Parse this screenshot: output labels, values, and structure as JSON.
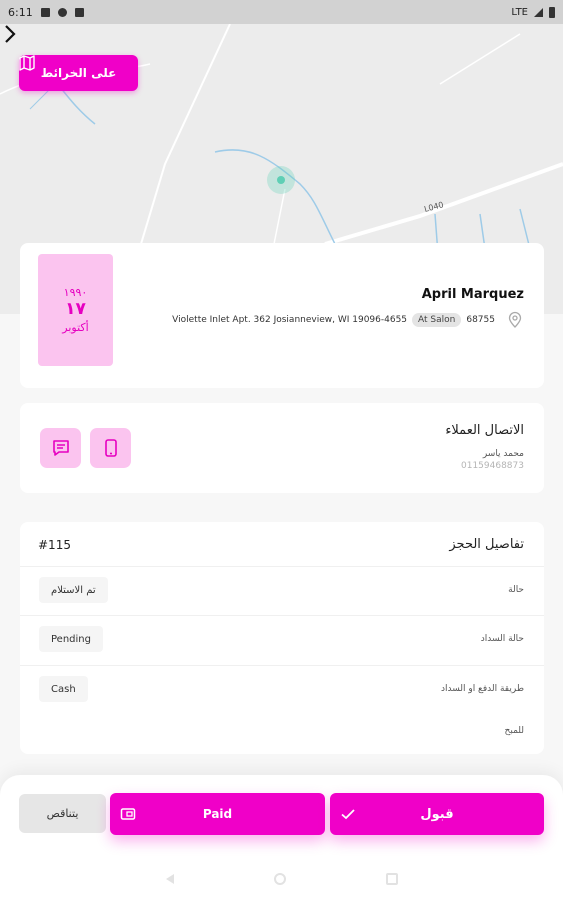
{
  "status_bar": {
    "time": "6:11",
    "network": "LTE"
  },
  "map": {
    "map_button_label": "على الخرائط"
  },
  "customer": {
    "name": "April Marquez",
    "address": "Violette Inlet Apt. 362 Josianneview, WI 19096-4655",
    "location_badge": "At Salon",
    "address_suffix": "68755",
    "date": {
      "year": "١٩٩٠",
      "day": "١٧",
      "month": "أكتوبر"
    }
  },
  "contact": {
    "title": "الاتصال العملاء",
    "person_name": "محمد ياسر",
    "phone": "01159468873"
  },
  "booking": {
    "title": "تفاصيل الحجز",
    "id": "#115",
    "rows": [
      {
        "label": "حالة",
        "value": "تم الاستلام"
      },
      {
        "label": "حالة السداد",
        "value": "Pending"
      },
      {
        "label": "طريقة الدفع او السداد",
        "value": "Cash"
      },
      {
        "label": "للمبح",
        "value": ""
      }
    ]
  },
  "actions": {
    "decline_label": "يتناقص",
    "paid_label": "Paid",
    "accept_label": "قبول"
  },
  "colors": {
    "accent": "#f000c8",
    "accent_light": "#fbc4ef",
    "map_marker": "#5fcfb5"
  },
  "icons": [
    "map-icon",
    "chevron-right-icon",
    "location-pin-icon",
    "chat-icon",
    "phone-icon",
    "wallet-icon",
    "check-icon"
  ]
}
